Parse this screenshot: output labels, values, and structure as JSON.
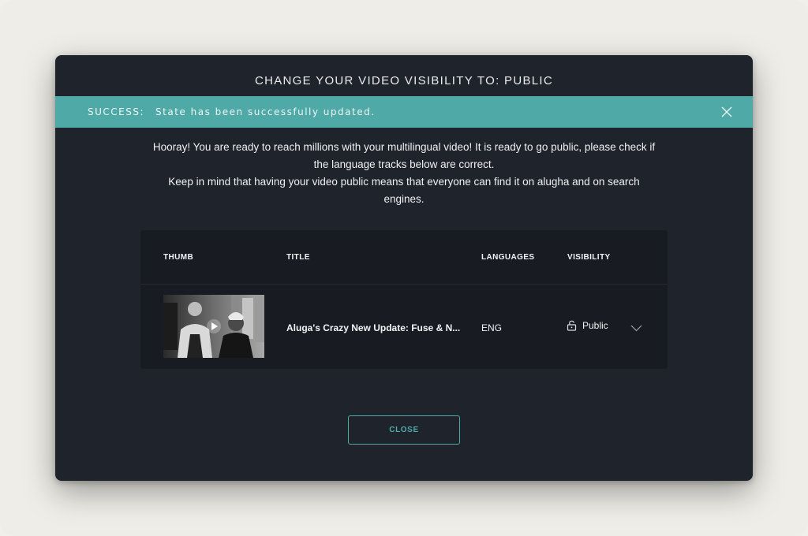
{
  "modal": {
    "title": "CHANGE YOUR VIDEO VISIBILITY TO: PUBLIC",
    "alert": {
      "label": "SUCCESS:",
      "message": "State has been successfully updated.",
      "color": "#4fa9a7"
    },
    "intro_lines": [
      "Hooray! You are ready to reach millions with your multilingual video! It is ready to go public, please check if",
      "the language tracks below are correct.",
      "Keep in mind that having your video public means that everyone can find it on alugha and on search",
      "engines."
    ],
    "table": {
      "headers": [
        "THUMB",
        "TITLE",
        "LANGUAGES",
        "VISIBILITY"
      ],
      "rows": [
        {
          "thumb_icon": "video-thumbnail",
          "title": "Aluga's Crazy New Update: Fuse & N...",
          "languages": "ENG",
          "visibility": "Public",
          "visibility_icon": "lock-open-icon"
        }
      ]
    },
    "close_label": "CLOSE"
  },
  "colors": {
    "background": "#eeede7",
    "modal": "#1f242c",
    "table": "#181c22",
    "accent": "#4fa9a7"
  }
}
